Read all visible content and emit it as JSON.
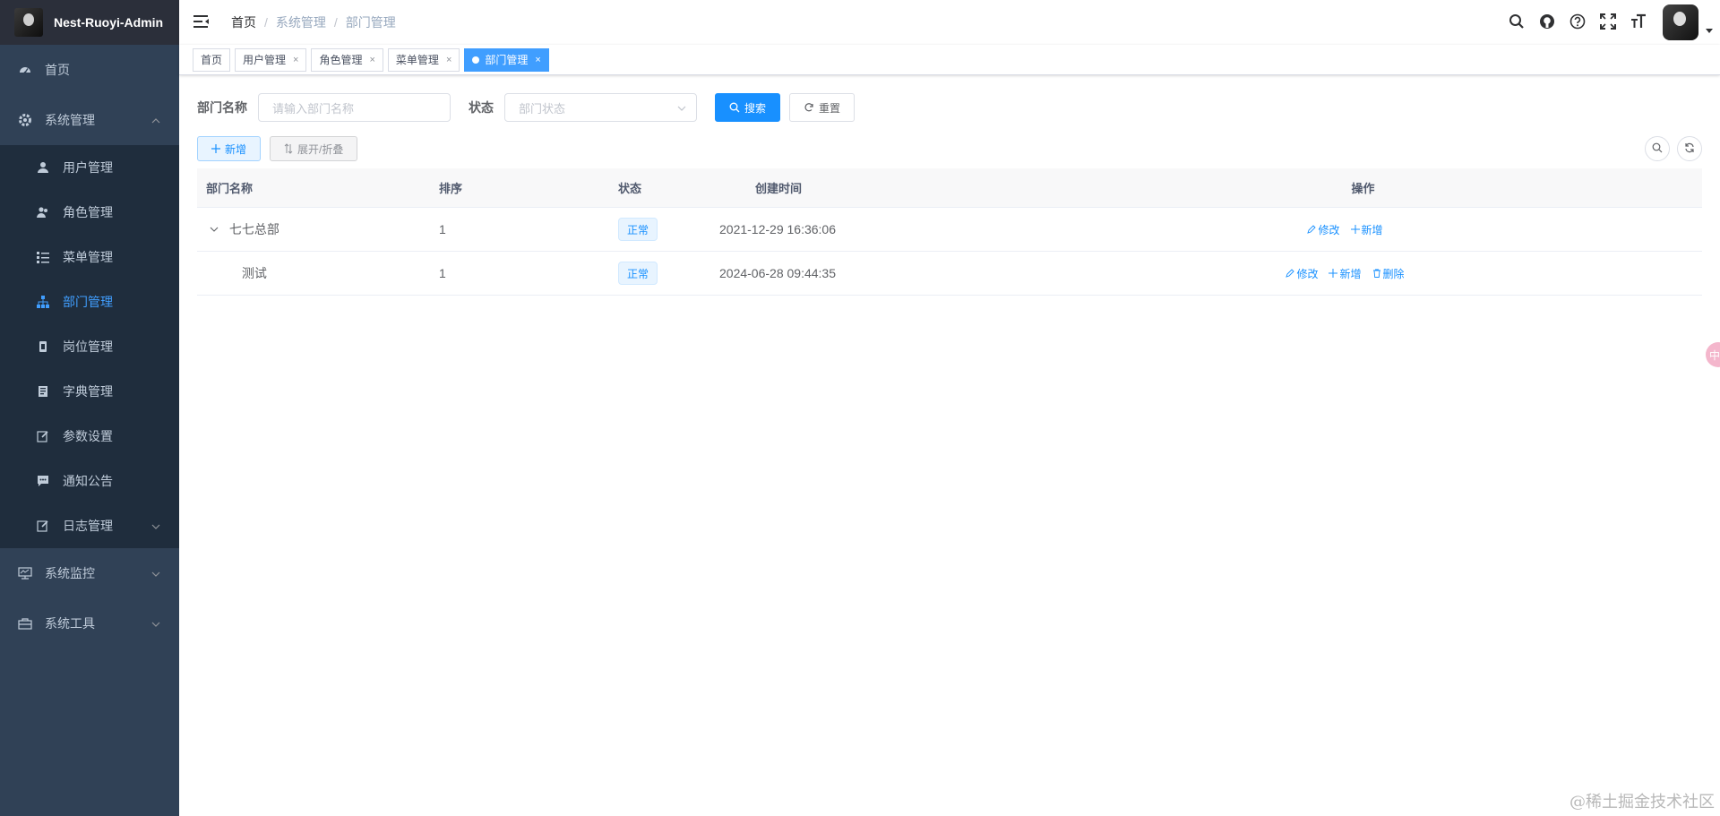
{
  "app": {
    "title": "Nest-Ruoyi-Admin"
  },
  "sidebar": {
    "items": [
      {
        "label": "首页",
        "icon": "dashboard-icon"
      },
      {
        "label": "系统管理",
        "icon": "gear-icon"
      },
      {
        "label": "系统监控",
        "icon": "monitor-icon"
      },
      {
        "label": "系统工具",
        "icon": "toolbox-icon"
      }
    ],
    "sub": [
      {
        "label": "用户管理",
        "icon": "user-icon"
      },
      {
        "label": "角色管理",
        "icon": "users-icon"
      },
      {
        "label": "菜单管理",
        "icon": "list-icon"
      },
      {
        "label": "部门管理",
        "icon": "tree-icon"
      },
      {
        "label": "岗位管理",
        "icon": "post-icon"
      },
      {
        "label": "字典管理",
        "icon": "book-icon"
      },
      {
        "label": "参数设置",
        "icon": "edit-icon"
      },
      {
        "label": "通知公告",
        "icon": "message-icon"
      },
      {
        "label": "日志管理",
        "icon": "log-icon"
      }
    ]
  },
  "breadcrumb": [
    "首页",
    "系统管理",
    "部门管理"
  ],
  "breadcrumb_sep": "/",
  "tags": [
    {
      "label": "首页"
    },
    {
      "label": "用户管理",
      "close": "×"
    },
    {
      "label": "角色管理",
      "close": "×"
    },
    {
      "label": "菜单管理",
      "close": "×"
    },
    {
      "label": "部门管理",
      "close": "×"
    }
  ],
  "search": {
    "dept_label": "部门名称",
    "dept_placeholder": "请输入部门名称",
    "status_label": "状态",
    "status_placeholder": "部门状态",
    "search_btn": "搜索",
    "reset_btn": "重置"
  },
  "toolbar": {
    "add_btn": "新增",
    "expand_btn": "展开/折叠"
  },
  "table": {
    "columns": [
      "部门名称",
      "排序",
      "状态",
      "创建时间",
      "操作"
    ],
    "rows": [
      {
        "name": "七七总部",
        "order": "1",
        "status": "正常",
        "created": "2021-12-29 16:36:06",
        "ops": [
          "修改",
          "新增"
        ]
      },
      {
        "name": "测试",
        "order": "1",
        "status": "正常",
        "created": "2024-06-28 09:44:35",
        "ops": [
          "修改",
          "新增",
          "删除"
        ]
      }
    ]
  },
  "watermark": "@稀土掘金技术社区",
  "float_badge": "中",
  "colors": {
    "primary": "#1890ff",
    "sidebar_bg": "#304156",
    "submenu_bg": "#1f2d3d"
  }
}
